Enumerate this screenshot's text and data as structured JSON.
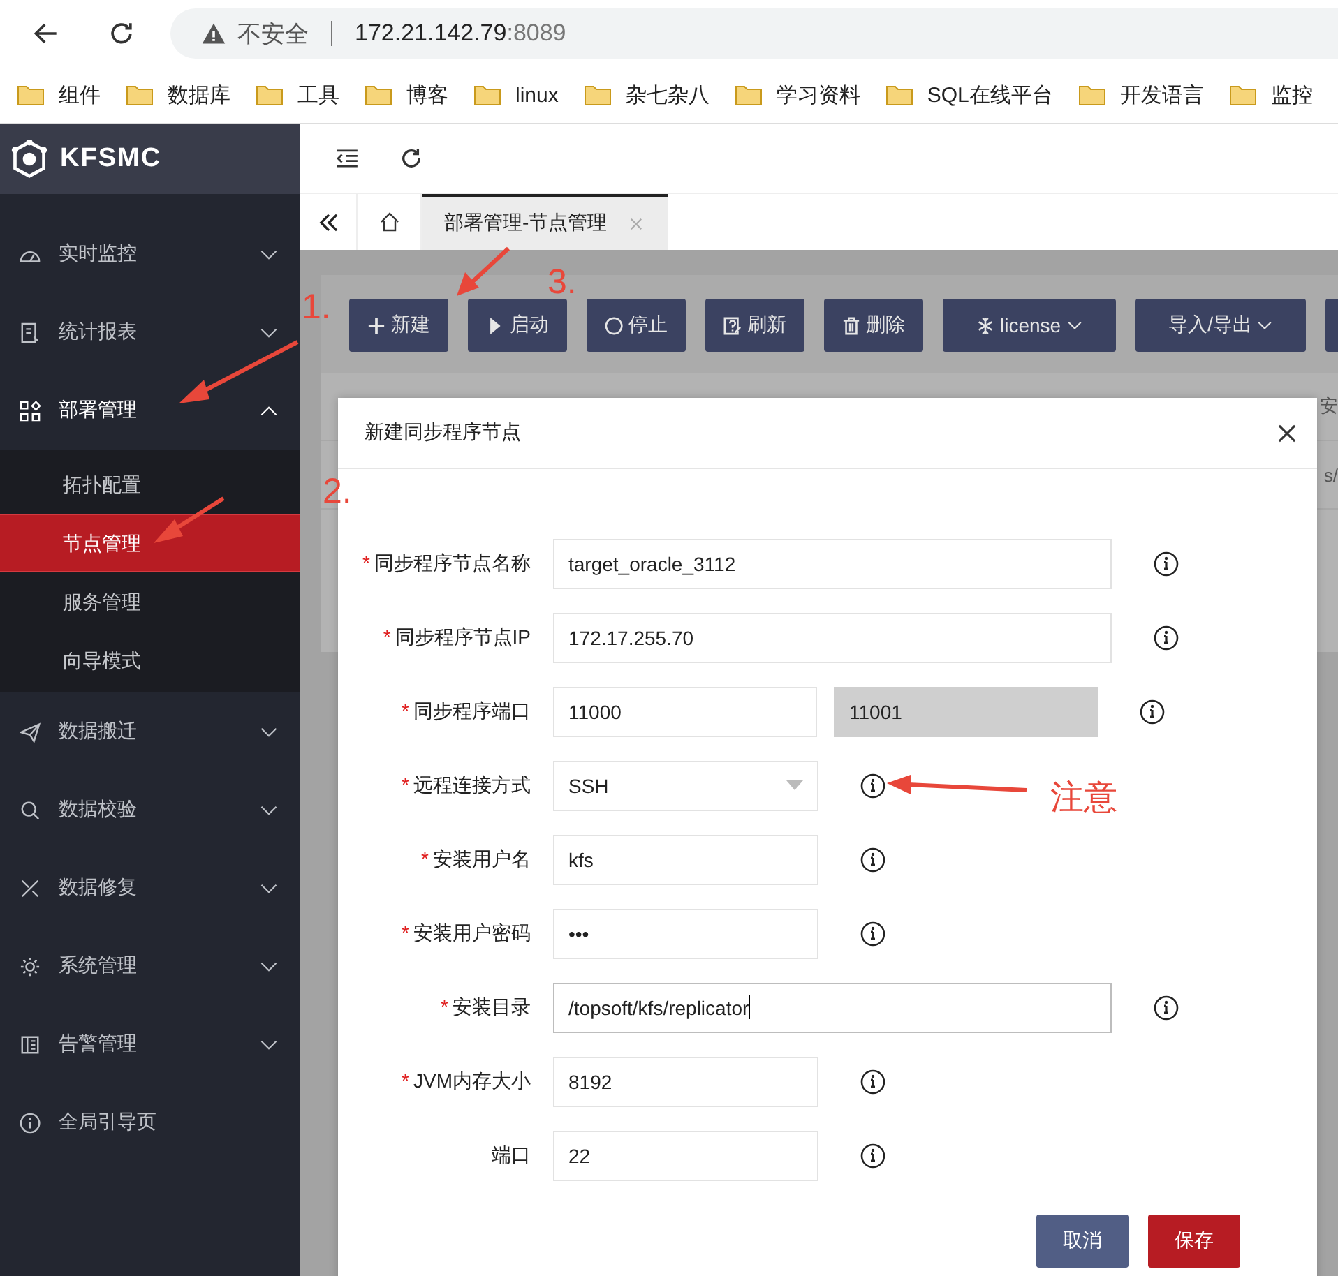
{
  "browser": {
    "warning": "不安全",
    "host": "172.21.142.79",
    "port": ":8089"
  },
  "bookmarks": [
    "组件",
    "数据库",
    "工具",
    "博客",
    "linux",
    "杂七杂八",
    "学习资料",
    "SQL在线平台",
    "开发语言",
    "监控"
  ],
  "sidebar": {
    "logo": "KFSMC",
    "items": [
      {
        "label": "实时监控",
        "kind": "group",
        "expanded": false
      },
      {
        "label": "统计报表",
        "kind": "group",
        "expanded": false
      },
      {
        "label": "部署管理",
        "kind": "group",
        "expanded": true,
        "children": [
          {
            "label": "拓扑配置",
            "selected": false
          },
          {
            "label": "节点管理",
            "selected": true
          },
          {
            "label": "服务管理",
            "selected": false
          },
          {
            "label": "向导模式",
            "selected": false
          }
        ]
      },
      {
        "label": "数据搬迁",
        "kind": "group",
        "expanded": false
      },
      {
        "label": "数据校验",
        "kind": "group",
        "expanded": false
      },
      {
        "label": "数据修复",
        "kind": "group",
        "expanded": false
      },
      {
        "label": "系统管理",
        "kind": "group",
        "expanded": false
      },
      {
        "label": "告警管理",
        "kind": "group",
        "expanded": false
      },
      {
        "label": "全局引导页",
        "kind": "link"
      }
    ]
  },
  "tabs": [
    {
      "label": "部署管理-节点管理",
      "selected": true
    }
  ],
  "toolbar": [
    {
      "label": "新建",
      "dropdown": false
    },
    {
      "label": "启动",
      "dropdown": false
    },
    {
      "label": "停止",
      "dropdown": false
    },
    {
      "label": "刷新",
      "dropdown": false
    },
    {
      "label": "删除",
      "dropdown": false
    },
    {
      "label": "license",
      "dropdown": true
    },
    {
      "label": "导入/导出",
      "dropdown": true
    },
    {
      "dropdown": false
    }
  ],
  "table": {
    "header_fragment": "安",
    "cell_fragment": "s/"
  },
  "dialog": {
    "title": "新建同步程序节点",
    "required_mark": "*",
    "fields": [
      {
        "label": "同步程序节点名称",
        "kind": "text",
        "required": true,
        "wide": true,
        "value": "target_oracle_3112"
      },
      {
        "label": "同步程序节点IP",
        "kind": "text",
        "required": true,
        "wide": true,
        "value": "172.17.255.70"
      },
      {
        "label": "同步程序端口",
        "kind": "pair",
        "required": true,
        "value": "11000",
        "value_2": "11001",
        "disabled_2": true
      },
      {
        "label": "远程连接方式",
        "kind": "select",
        "required": true,
        "value": "SSH"
      },
      {
        "label": "安装用户名",
        "kind": "text",
        "required": true,
        "wide": false,
        "value": "kfs"
      },
      {
        "label": "安装用户密码",
        "kind": "password",
        "required": true,
        "wide": false,
        "value": "•••"
      },
      {
        "label": "安装目录",
        "kind": "text",
        "required": true,
        "wide": true,
        "focused": true,
        "value": "/topsoft/kfs/replicator"
      },
      {
        "label": "JVM内存大小",
        "kind": "text",
        "required": true,
        "wide": false,
        "value": "8192"
      },
      {
        "label": "端口",
        "kind": "text",
        "required": false,
        "wide": false,
        "value": "22"
      }
    ],
    "buttons": [
      {
        "label": "取消",
        "kind": "secondary"
      },
      {
        "label": "保存",
        "kind": "primary"
      }
    ]
  },
  "annotations": [
    "1.",
    "2.",
    "3.",
    "注意"
  ]
}
